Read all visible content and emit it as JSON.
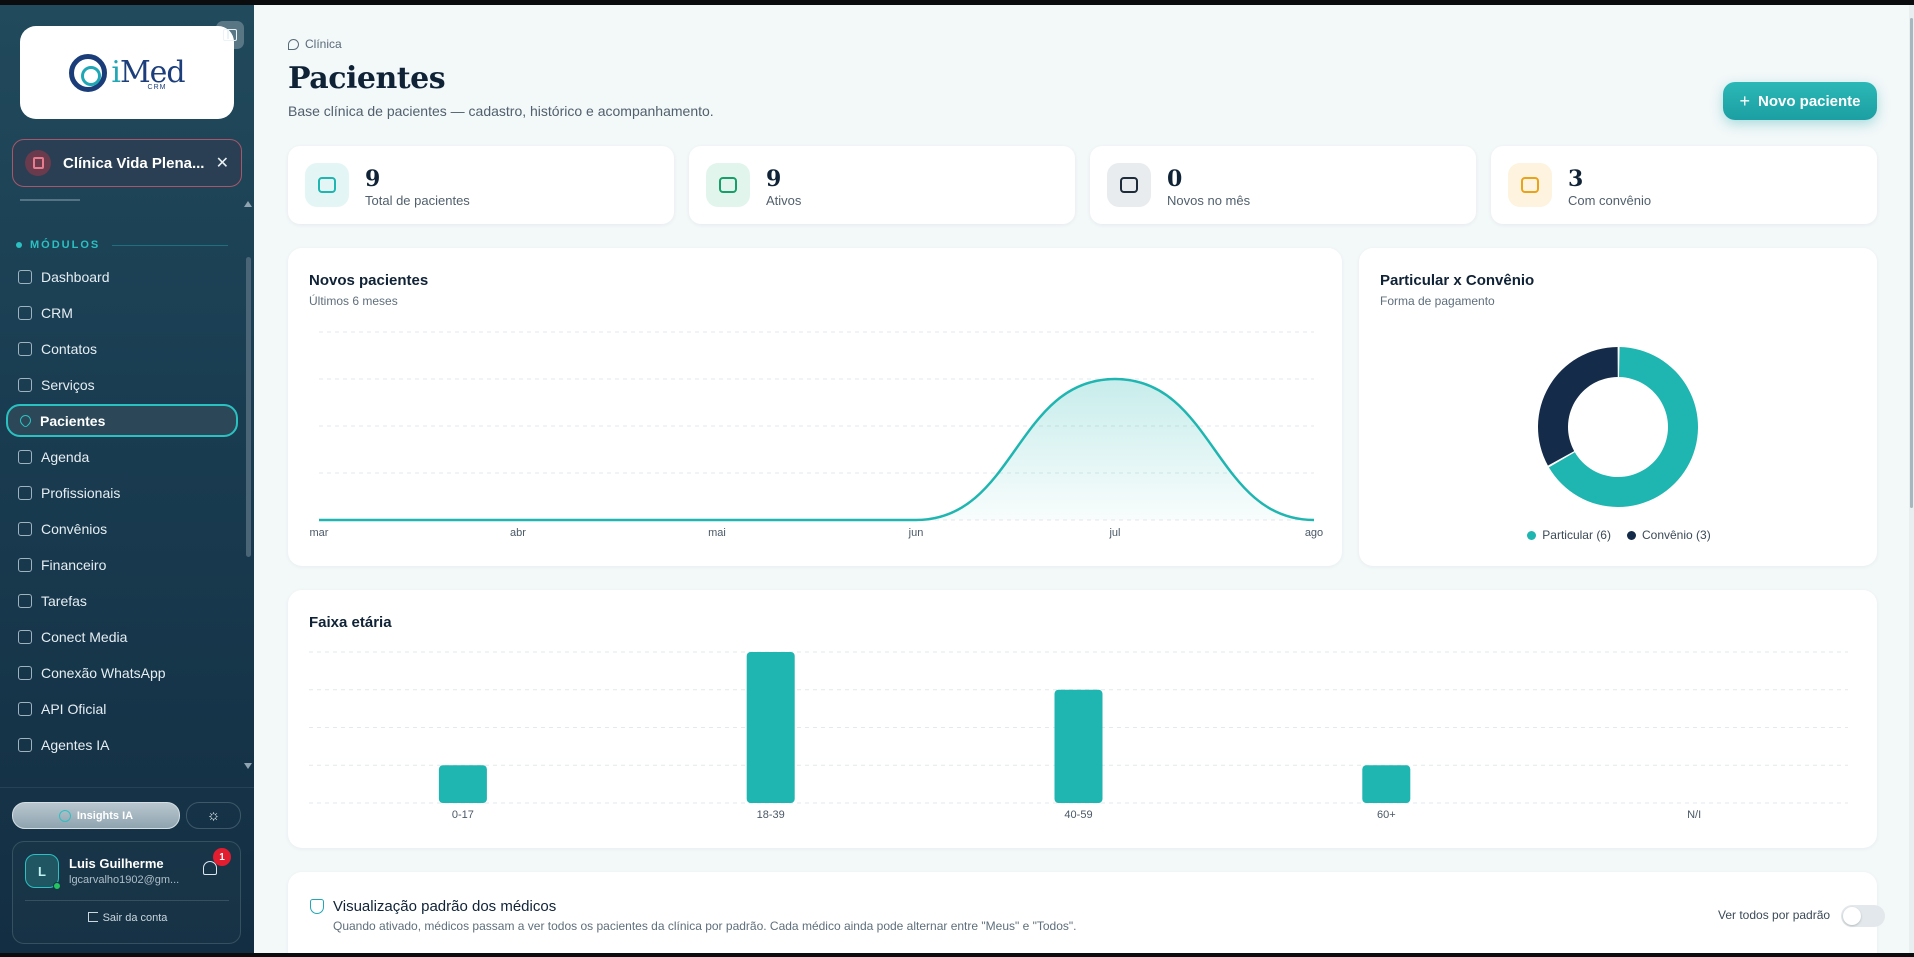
{
  "sidebar": {
    "logo": {
      "text_i": "i",
      "text_med": "Med",
      "sub": "CRM"
    },
    "clinic_name": "Clínica Vida Plena...",
    "modules_title": "MÓDULOS",
    "items": [
      {
        "label": "Dashboard",
        "icon": "home-icon"
      },
      {
        "label": "CRM",
        "icon": "grid-icon"
      },
      {
        "label": "Contatos",
        "icon": "contacts-icon"
      },
      {
        "label": "Serviços",
        "icon": "box-icon"
      },
      {
        "label": "Pacientes",
        "icon": "heart-icon",
        "active": true
      },
      {
        "label": "Agenda",
        "icon": "calendar-icon"
      },
      {
        "label": "Profissionais",
        "icon": "stethoscope-icon"
      },
      {
        "label": "Convênios",
        "icon": "shield-icon"
      },
      {
        "label": "Financeiro",
        "icon": "wallet-icon"
      },
      {
        "label": "Tarefas",
        "icon": "checkbox-icon"
      },
      {
        "label": "Conect Media",
        "icon": "bar-chart-icon"
      },
      {
        "label": "Conexão WhatsApp",
        "icon": "phone-icon"
      },
      {
        "label": "API Oficial",
        "icon": "phone-icon"
      },
      {
        "label": "Agentes IA",
        "icon": "bot-icon"
      }
    ],
    "insights_label": "Insights IA",
    "user": {
      "initial": "L",
      "name": "Luis Guilherme",
      "email": "lgcarvalho1902@gm...",
      "notifications": "1"
    },
    "logout_label": "Sair da conta"
  },
  "header": {
    "breadcrumb": "Clínica",
    "title": "Pacientes",
    "subtitle": "Base clínica de pacientes — cadastro, histórico e acompanhamento.",
    "new_button": "Novo paciente"
  },
  "stats": [
    {
      "value": "9",
      "label": "Total de pacientes",
      "icon": "users-icon",
      "color": "#1fb5b0",
      "bg": "#e3f6f5"
    },
    {
      "value": "9",
      "label": "Ativos",
      "icon": "heart-pulse-icon",
      "color": "#15a06a",
      "bg": "#e2f5ec"
    },
    {
      "value": "0",
      "label": "Novos no mês",
      "icon": "calendar-plus-icon",
      "color": "#1d2b3a",
      "bg": "#e8ecef"
    },
    {
      "value": "3",
      "label": "Com convênio",
      "icon": "shield-check-icon",
      "color": "#e8a31a",
      "bg": "#fdf3df"
    }
  ],
  "cards": {
    "new_patients": {
      "title": "Novos pacientes",
      "subtitle": "Últimos 6 meses"
    },
    "payment": {
      "title": "Particular x Convênio",
      "subtitle": "Forma de pagamento"
    },
    "age": {
      "title": "Faixa etária"
    }
  },
  "chart_data": [
    {
      "type": "area",
      "categories": [
        "mar",
        "abr",
        "mai",
        "jun",
        "jul",
        "ago"
      ],
      "values": [
        0,
        0,
        0,
        0,
        3,
        0
      ],
      "ylim": [
        0,
        4
      ],
      "grid": true,
      "color": "#1fb5b0"
    },
    {
      "type": "pie",
      "labels": [
        "Particular (6)",
        "Convênio (3)"
      ],
      "values": [
        6,
        3
      ],
      "colors": [
        "#1fb5b0",
        "#142b4a"
      ],
      "legend": "bottom"
    },
    {
      "type": "bar",
      "categories": [
        "0-17",
        "18-39",
        "40-59",
        "60+",
        "N/I"
      ],
      "values": [
        1,
        4,
        3,
        1,
        0
      ],
      "ylim": [
        0,
        4
      ],
      "grid": true,
      "color": "#1fb5b0"
    }
  ],
  "visibility": {
    "title": "Visualização padrão dos médicos",
    "description": "Quando ativado, médicos passam a ver todos os pacientes da clínica por padrão. Cada médico ainda pode alternar entre \"Meus\" e \"Todos\".",
    "toggle_label": "Ver todos por padrão",
    "toggle_on": false
  }
}
